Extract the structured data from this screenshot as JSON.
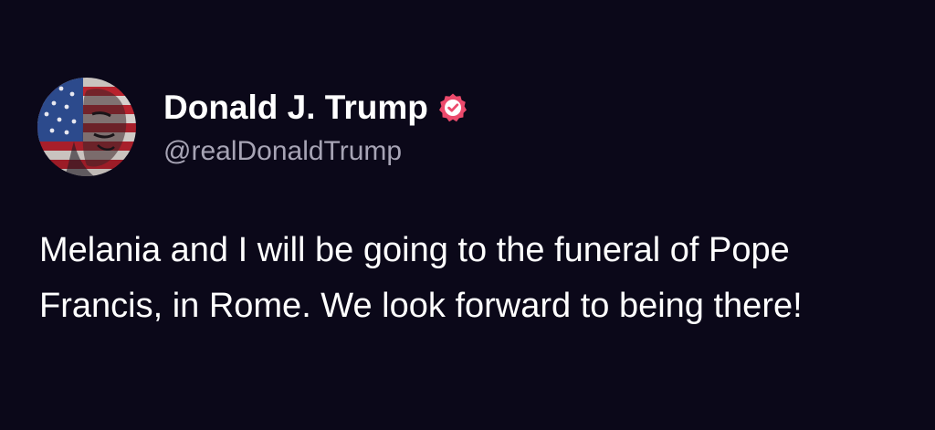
{
  "author": {
    "display_name": "Donald J. Trump",
    "handle": "@realDonaldTrump",
    "verified": true,
    "verified_color": "#ec4a6c",
    "avatar_icon": "flag-portrait-avatar"
  },
  "post": {
    "text": "Melania and I will be going to the funeral of Pope Francis, in Rome. We look forward to being there!"
  },
  "colors": {
    "background": "#0b0819",
    "text": "#ffffff",
    "secondary_text": "#a7a4b5"
  }
}
